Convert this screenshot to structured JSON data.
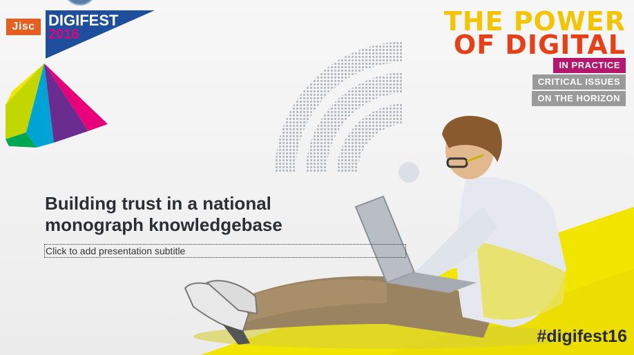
{
  "slide": {
    "logo": {
      "jisc": "Jisc",
      "event": "DIGIFEST",
      "year": "2016"
    },
    "headline": {
      "line1": "THE POWER",
      "line2": "OF DIGITAL",
      "tag1": "IN PRACTICE",
      "tag2": "CRITICAL ISSUES",
      "tag3": "ON THE HORIZON"
    },
    "title_line1": "Building trust in a national",
    "title_line2": "monograph knowledgebase",
    "subtitle_placeholder": "Click to add presentation subtitle",
    "hashtag": "#digifest16"
  },
  "colors": {
    "jisc_orange": "#e85e1e",
    "digifest_blue": "#1f4f9c",
    "magenta": "#e8007a",
    "yellow": "#f2e500",
    "headline_yellow": "#f4c400",
    "headline_red": "#e84016"
  },
  "icons": [
    "wifi-graphic",
    "prism-graphic",
    "person-with-laptop-photo"
  ]
}
